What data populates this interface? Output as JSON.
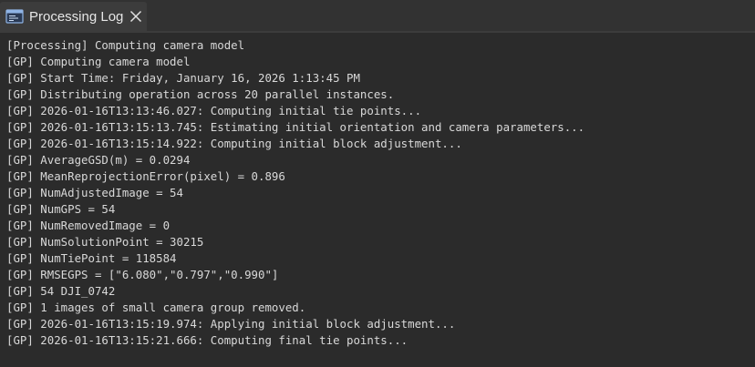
{
  "tab": {
    "title": "Processing Log",
    "icon": "console-window-icon",
    "close_icon": "close-icon"
  },
  "colors": {
    "background": "#2b2b2b",
    "tab_background": "#3c3c3c",
    "text": "#d8d8d8"
  },
  "log": {
    "lines": [
      "[Processing] Computing camera model",
      "[GP] Computing camera model",
      "[GP] Start Time: Friday, January 16, 2026 1:13:45 PM",
      "[GP] Distributing operation across 20 parallel instances.",
      "[GP] 2026-01-16T13:13:46.027: Computing initial tie points...",
      "[GP] 2026-01-16T13:15:13.745: Estimating initial orientation and camera parameters...",
      "[GP] 2026-01-16T13:15:14.922: Computing initial block adjustment...",
      "[GP] AverageGSD(m) = 0.0294",
      "[GP] MeanReprojectionError(pixel) = 0.896",
      "[GP] NumAdjustedImage = 54",
      "[GP] NumGPS = 54",
      "[GP] NumRemovedImage = 0",
      "[GP] NumSolutionPoint = 30215",
      "[GP] NumTiePoint = 118584",
      "[GP] RMSEGPS = [\"6.080\",\"0.797\",\"0.990\"]",
      "[GP] 54 DJI_0742",
      "[GP] 1 images of small camera group removed.",
      "[GP] 2026-01-16T13:15:19.974: Applying initial block adjustment...",
      "[GP] 2026-01-16T13:15:21.666: Computing final tie points..."
    ]
  }
}
